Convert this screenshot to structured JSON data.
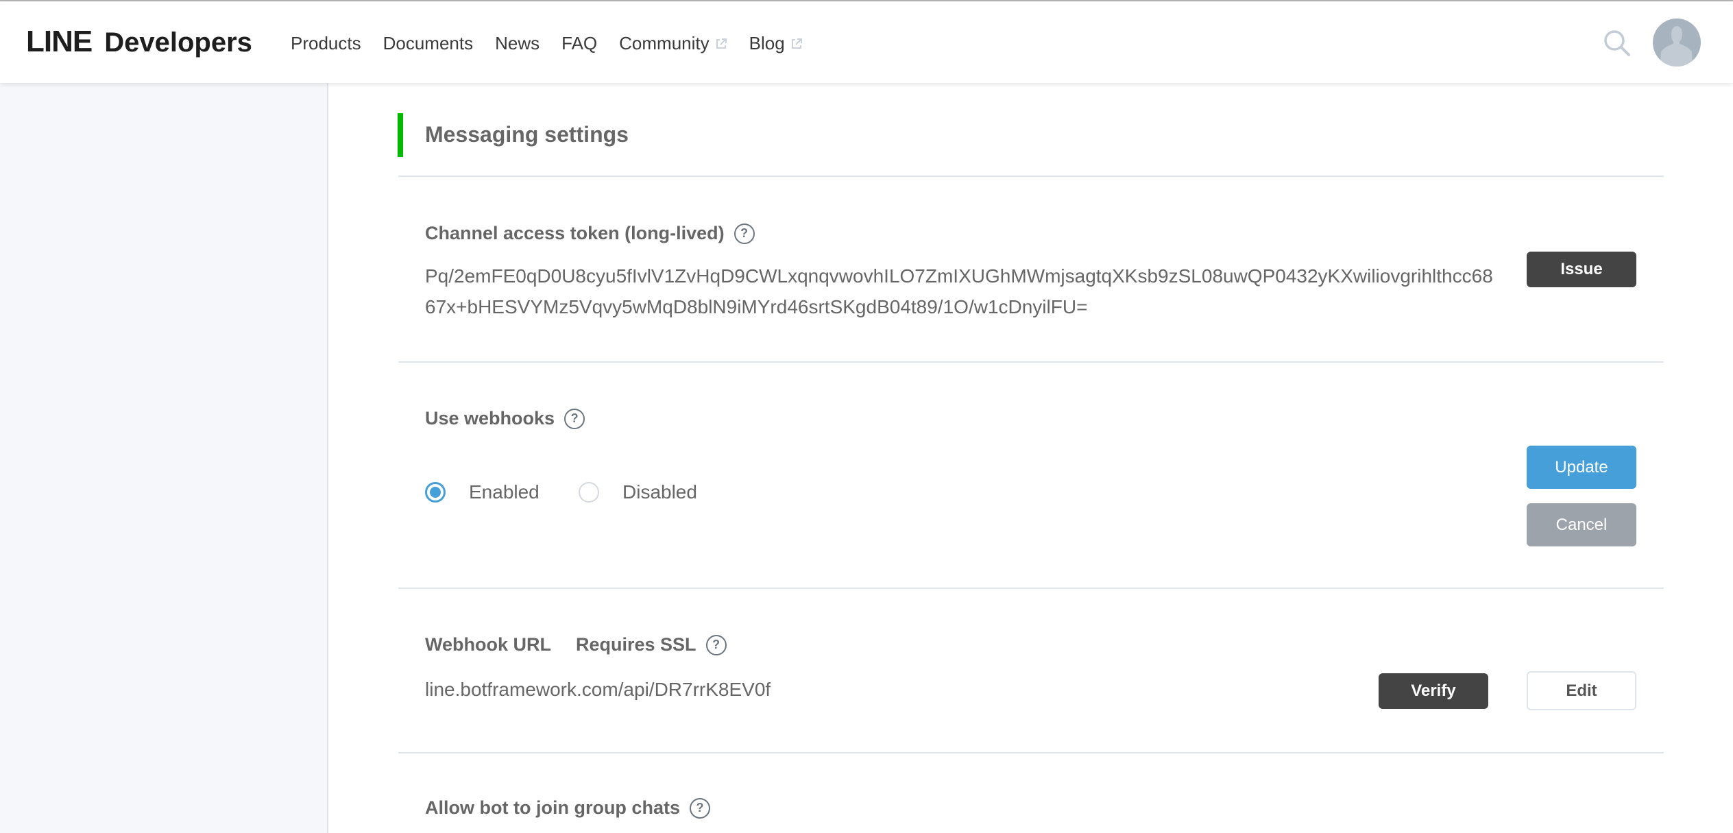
{
  "header": {
    "logo_line": "LINE",
    "logo_developers": "Developers",
    "nav": [
      {
        "label": "Products",
        "external": false
      },
      {
        "label": "Documents",
        "external": false
      },
      {
        "label": "News",
        "external": false
      },
      {
        "label": "FAQ",
        "external": false
      },
      {
        "label": "Community",
        "external": true
      },
      {
        "label": "Blog",
        "external": true
      }
    ],
    "search_icon": "search-icon",
    "avatar_icon": "user-avatar-icon"
  },
  "colors": {
    "accent_green": "#00b900",
    "primary_blue": "#469fd8",
    "dark_button": "#444444",
    "gray_button": "#9ca3aa"
  },
  "section": {
    "title": "Messaging settings"
  },
  "channel_token": {
    "label": "Channel access token (long-lived)",
    "help": "?",
    "value": "Pq/2emFE0qD0U8cyu5fIvlV1ZvHqD9CWLxqnqvwovhILO7ZmIXUGhMWmjsagtqXKsb9zSL08uwQP0432yKXwiliovgrihlthcc6867x+bHESVYMz5Vqvy5wMqD8blN9iMYrd46srtSKgdB04t89/1O/w1cDnyilFU=",
    "issue_button": "Issue"
  },
  "webhooks": {
    "label": "Use webhooks",
    "help": "?",
    "options": [
      {
        "label": "Enabled",
        "selected": true
      },
      {
        "label": "Disabled",
        "selected": false
      }
    ],
    "update_button": "Update",
    "cancel_button": "Cancel"
  },
  "webhook_url": {
    "label": "Webhook URL",
    "ssl_label": "Requires SSL",
    "help": "?",
    "value": "line.botframework.com/api/DR7rrK8EV0f",
    "verify_button": "Verify",
    "edit_button": "Edit"
  },
  "group_chats": {
    "label": "Allow bot to join group chats",
    "help": "?"
  }
}
